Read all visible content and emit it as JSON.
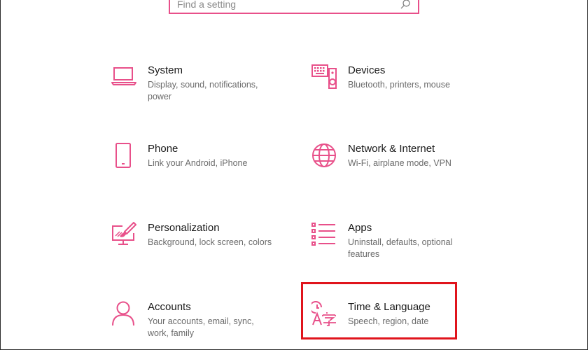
{
  "search": {
    "placeholder": "Find a setting"
  },
  "colors": {
    "accent": "#e8508a",
    "highlight": "#e0141c"
  },
  "tiles": [
    {
      "title": "System",
      "description": "Display, sound, notifications, power",
      "icon": "laptop-icon"
    },
    {
      "title": "Devices",
      "description": "Bluetooth, printers, mouse",
      "icon": "keyboard-speaker-icon"
    },
    {
      "title": "Phone",
      "description": "Link your Android, iPhone",
      "icon": "phone-icon"
    },
    {
      "title": "Network & Internet",
      "description": "Wi-Fi, airplane mode, VPN",
      "icon": "globe-icon"
    },
    {
      "title": "Personalization",
      "description": "Background, lock screen, colors",
      "icon": "paint-monitor-icon"
    },
    {
      "title": "Apps",
      "description": "Uninstall, defaults, optional features",
      "icon": "apps-list-icon"
    },
    {
      "title": "Accounts",
      "description": "Your accounts, email, sync, work, family",
      "icon": "person-icon"
    },
    {
      "title": "Time & Language",
      "description": "Speech, region, date",
      "icon": "time-language-icon"
    }
  ]
}
